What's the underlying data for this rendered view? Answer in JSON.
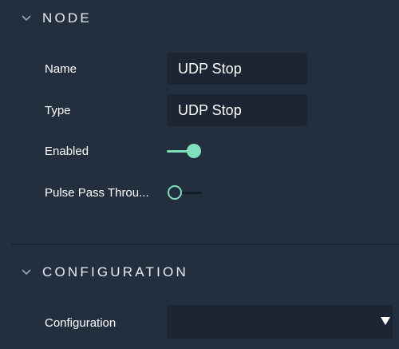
{
  "node_section": {
    "title": "NODE",
    "chevron_icon": "chevron-down-icon",
    "rows": {
      "name": {
        "label": "Name",
        "value": "UDP Stop"
      },
      "type": {
        "label": "Type",
        "value": "UDP Stop"
      },
      "enabled": {
        "label": "Enabled",
        "state": "on"
      },
      "pulse_pass_through": {
        "label": "Pulse Pass Throu...",
        "state": "off"
      }
    }
  },
  "configuration_section": {
    "title": "CONFIGURATION",
    "chevron_icon": "chevron-down-icon",
    "rows": {
      "configuration": {
        "label": "Configuration",
        "value": ""
      }
    }
  },
  "colors": {
    "background": "#232f3f",
    "field_background": "#1b2533",
    "accent": "#7fe0bb",
    "toggle_off_track": "#151d28"
  }
}
